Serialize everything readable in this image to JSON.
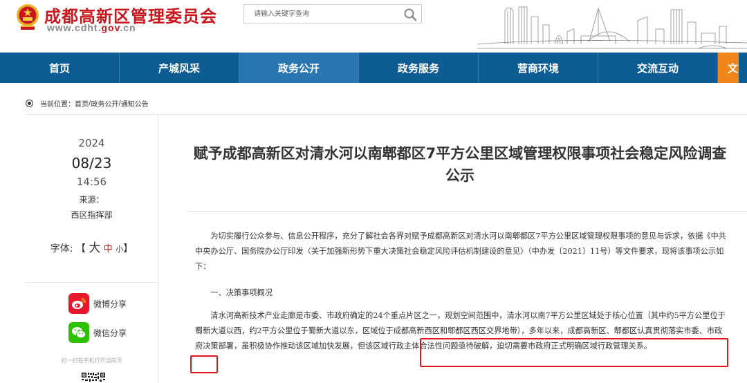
{
  "header": {
    "site_title": "成都高新区管理委员会",
    "site_url_prefix": "www.cdht.",
    "site_url_gov": "gov",
    "site_url_suffix": ".cn",
    "search_placeholder": "请输入关键字查询"
  },
  "nav": {
    "items": [
      {
        "label": "首页"
      },
      {
        "label": "产城风采"
      },
      {
        "label": "政务公开",
        "active": true
      },
      {
        "label": "政务服务"
      },
      {
        "label": "营商环境"
      },
      {
        "label": "交流互动"
      },
      {
        "label": "文"
      }
    ]
  },
  "breadcrumb": {
    "label": "当前位置：",
    "home": "首页",
    "sep1": " / ",
    "section": "政务公开",
    "sep2": " / ",
    "current": "通知公告"
  },
  "sidebar": {
    "year": "2024",
    "date": "08/23",
    "time": "14:56",
    "source_label": "来源：",
    "source": "西区指挥部",
    "font_label": "字体:",
    "font_open": "【",
    "font_big": "大",
    "font_mid": "中",
    "font_small": "小",
    "font_close": "】",
    "weibo_share": "微博分享",
    "wechat_share": "微信分享",
    "scan_tip": "扫一扫在手机打开当前页"
  },
  "article": {
    "title": "赋予成都高新区对清水河以南郫都区7平方公里区域管理权限事项社会稳定风险调查公示",
    "paragraphs": [
      "为切实履行公众参与、信息公开程序，充分了解社会各界对赋予成都高新区对清水河以南郫都区7平方公里区域管理权限事项的意见与诉求，依据《中共中央办公厅、国务院办公厅印发〈关于加强新形势下重大决策社会稳定风险评估机制建设的意见〉（中办发〔2021〕11号）等文件要求，现将该事项公示如下：",
      "一、决策事项概况",
      "清水河高新技术产业走廊是市委、市政府确定的24个重点片区之一，规划空间范围中，清水河以南7平方公里区域处于核心位置（其中约5平方公里位于蜀新大道以西，约2平方公里位于蜀新大道以东，区域位于成都高新西区和郫都区西区交界地带），多年以来，成都高新区、郫都区认真贯彻落实市委、市政府决策部署，虽积极协作推动该区域加快发展，但该区域行政主体合法性问题亟待破解，迫切需要市政府正式明确区域行政管理关系。"
    ]
  },
  "colors": {
    "brand_red": "#c8161d",
    "nav_blue": "#0e5c94",
    "nav_active": "#2a76b3",
    "nav_orange": "#f08519",
    "highlight_red": "#e0141e"
  }
}
